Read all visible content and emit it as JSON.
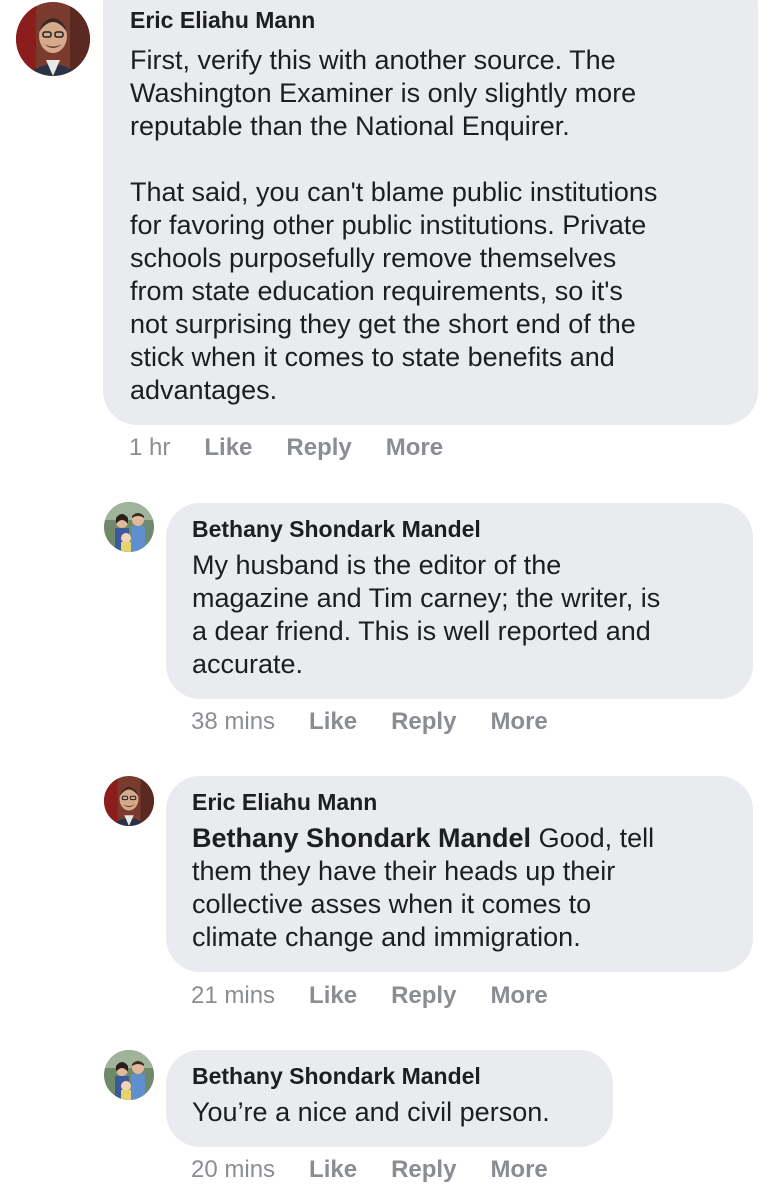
{
  "comments": [
    {
      "author": "Eric Eliahu Mann",
      "avatar": "eric-avatar",
      "body": "First, verify this with another source. The\nWashington Examiner is only slightly more\nreputable than the National Enquirer.\n\nThat said, you can't blame public institutions\nfor favoring other public institutions. Private\nschools purposefully remove themselves\nfrom state education requirements, so it's\nnot surprising they get the short end of the\nstick when it comes to state benefits and\nadvantages.",
      "time": "1 hr",
      "like": "Like",
      "reply": "Reply",
      "more": "More"
    },
    {
      "author": "Bethany Shondark Mandel",
      "avatar": "bethany-avatar",
      "body": "My husband is the editor of the\nmagazine and Tim carney; the writer, is\na dear friend. This is well reported and\naccurate.",
      "time": "38 mins",
      "like": "Like",
      "reply": "Reply",
      "more": "More"
    },
    {
      "author": "Eric Eliahu Mann",
      "avatar": "eric-avatar",
      "mention": "Bethany Shondark Mandel",
      "body": " Good, tell\nthem they have their heads up their\ncollective asses when it comes to\nclimate change and immigration.",
      "time": "21 mins",
      "like": "Like",
      "reply": "Reply",
      "more": "More"
    },
    {
      "author": "Bethany Shondark Mandel",
      "avatar": "bethany-avatar",
      "body": "You’re a nice and civil person.",
      "time": "20 mins",
      "like": "Like",
      "reply": "Reply",
      "more": "More"
    }
  ],
  "colors": {
    "bubble": "#eaebef",
    "text": "#1c1e21",
    "meta": "#8a8d91"
  }
}
